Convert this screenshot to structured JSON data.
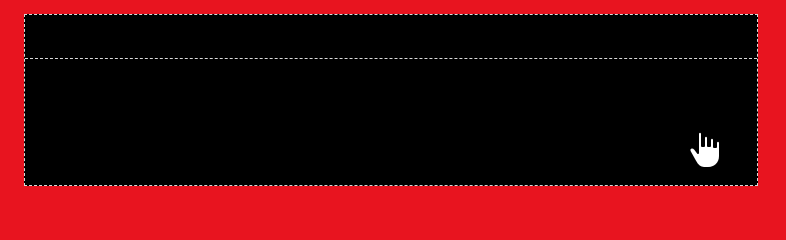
{
  "colors": {
    "background": "#e8141f",
    "panel": "#000000",
    "dashed_border": "#d9d9d9",
    "cursor_fill": "#ffffff",
    "cursor_stroke": "#000000"
  },
  "icons": {
    "cursor": "pointing-hand-cursor-icon"
  }
}
